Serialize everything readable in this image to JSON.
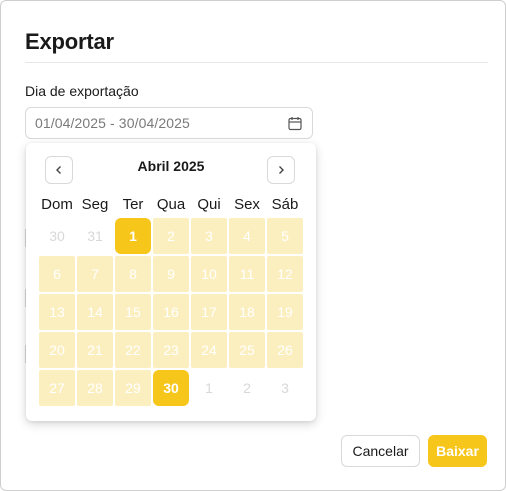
{
  "modal": {
    "title": "Exportar",
    "field_label": "Dia de exportação",
    "date_range_value": "01/04/2025 - 30/04/2025",
    "calendar_icon": "calendar-icon"
  },
  "calendar": {
    "month_label": "Abril 2025",
    "prev_icon": "chevron-left-icon",
    "next_icon": "chevron-right-icon",
    "weekdays": [
      "Dom",
      "Seg",
      "Ter",
      "Qua",
      "Qui",
      "Sex",
      "Sáb"
    ],
    "weeks": [
      [
        {
          "d": "30",
          "s": "outside"
        },
        {
          "d": "31",
          "s": "outside"
        },
        {
          "d": "1",
          "s": "edge"
        },
        {
          "d": "2",
          "s": "range"
        },
        {
          "d": "3",
          "s": "range"
        },
        {
          "d": "4",
          "s": "range"
        },
        {
          "d": "5",
          "s": "range"
        }
      ],
      [
        {
          "d": "6",
          "s": "range"
        },
        {
          "d": "7",
          "s": "range"
        },
        {
          "d": "8",
          "s": "range"
        },
        {
          "d": "9",
          "s": "range"
        },
        {
          "d": "10",
          "s": "range"
        },
        {
          "d": "11",
          "s": "range"
        },
        {
          "d": "12",
          "s": "range"
        }
      ],
      [
        {
          "d": "13",
          "s": "range"
        },
        {
          "d": "14",
          "s": "range"
        },
        {
          "d": "15",
          "s": "range"
        },
        {
          "d": "16",
          "s": "range"
        },
        {
          "d": "17",
          "s": "range"
        },
        {
          "d": "18",
          "s": "range"
        },
        {
          "d": "19",
          "s": "range"
        }
      ],
      [
        {
          "d": "20",
          "s": "range"
        },
        {
          "d": "21",
          "s": "range"
        },
        {
          "d": "22",
          "s": "range"
        },
        {
          "d": "23",
          "s": "range"
        },
        {
          "d": "24",
          "s": "range"
        },
        {
          "d": "25",
          "s": "range"
        },
        {
          "d": "26",
          "s": "range"
        }
      ],
      [
        {
          "d": "27",
          "s": "range"
        },
        {
          "d": "28",
          "s": "range"
        },
        {
          "d": "29",
          "s": "range"
        },
        {
          "d": "30",
          "s": "edge"
        },
        {
          "d": "1",
          "s": "outside"
        },
        {
          "d": "2",
          "s": "outside"
        },
        {
          "d": "3",
          "s": "outside"
        }
      ]
    ]
  },
  "footer": {
    "cancel_label": "Cancelar",
    "download_label": "Baixar"
  },
  "colors": {
    "accent": "#f6c61b",
    "range_fill": "#fcefbf",
    "border": "#d9d9d9"
  }
}
